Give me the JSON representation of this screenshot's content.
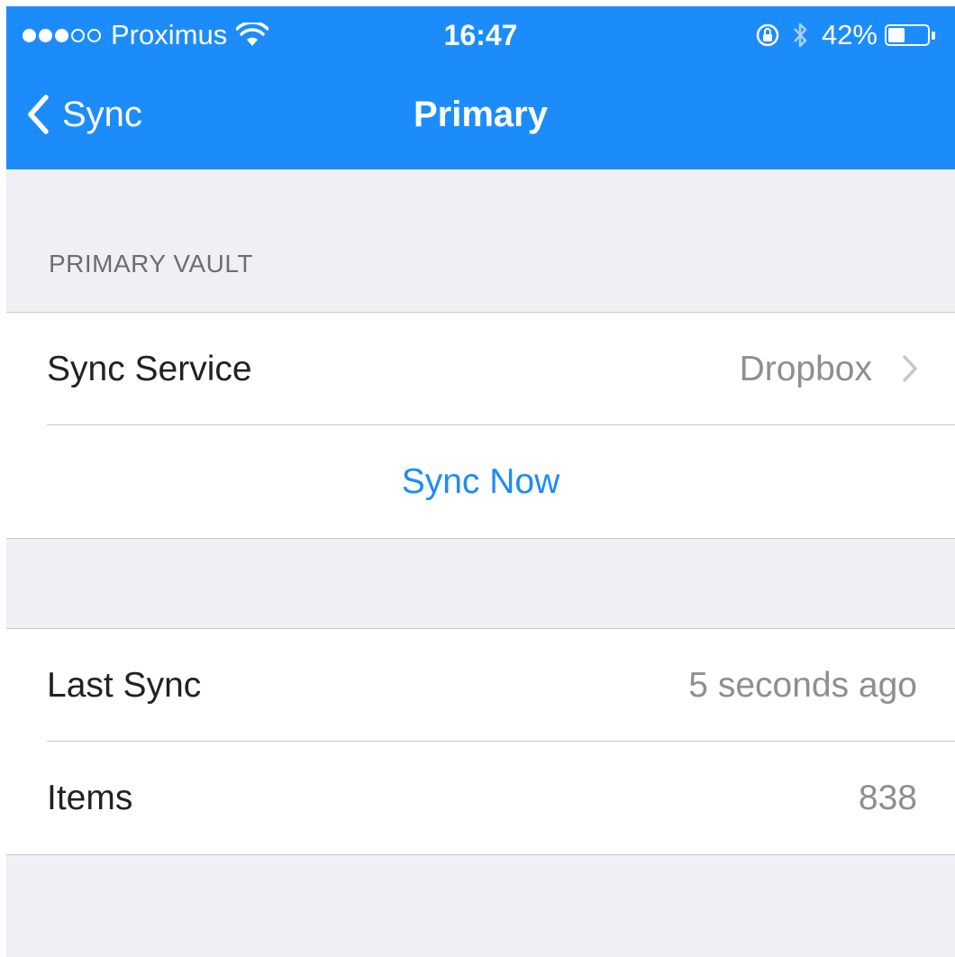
{
  "status_bar": {
    "signal": [
      "full",
      "full",
      "full",
      "empty",
      "empty"
    ],
    "carrier": "Proximus",
    "time": "16:47",
    "battery_percent_label": "42%",
    "battery_level": 0.42
  },
  "nav": {
    "back_label": "Sync",
    "title": "Primary"
  },
  "vault_section": {
    "header": "PRIMARY VAULT",
    "sync_service_label": "Sync Service",
    "sync_service_value": "Dropbox",
    "sync_now_label": "Sync Now"
  },
  "info_section": {
    "last_sync_label": "Last Sync",
    "last_sync_value": "5 seconds ago",
    "items_label": "Items",
    "items_value": "838"
  },
  "colors": {
    "accent": "#1c8cfb",
    "background": "#efeff4",
    "separator": "#c8c7cc",
    "secondary_text": "#8e8e93"
  },
  "icons": [
    "wifi-icon",
    "rotation-lock-icon",
    "bluetooth-icon",
    "battery-icon",
    "back-chevron-icon",
    "chevron-right-icon"
  ]
}
